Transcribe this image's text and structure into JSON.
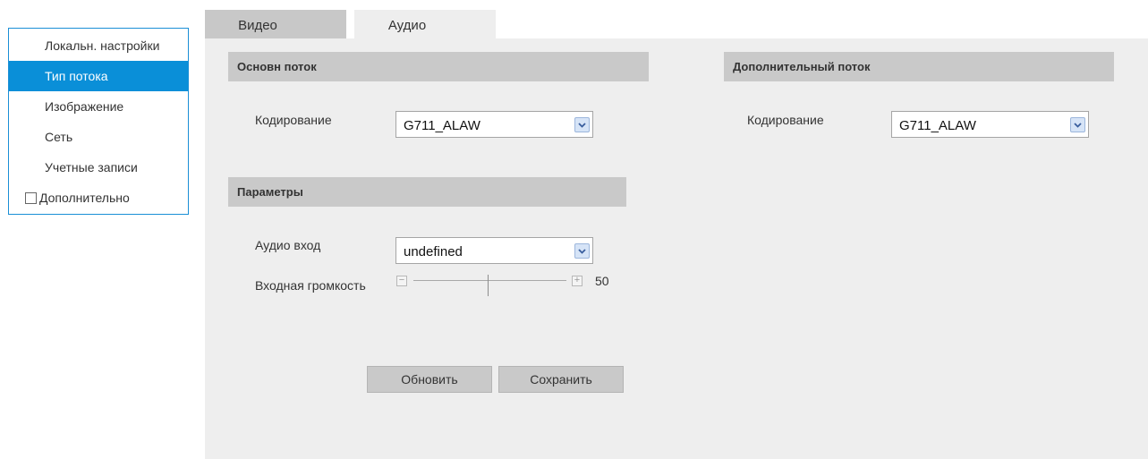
{
  "sidebar": {
    "items": [
      {
        "label": "Локальн. настройки"
      },
      {
        "label": "Тип потока"
      },
      {
        "label": "Изображение"
      },
      {
        "label": "Сеть"
      },
      {
        "label": "Учетные записи"
      },
      {
        "label": "Дополнительно"
      }
    ],
    "active_index": 1
  },
  "tabs": [
    {
      "label": "Видео"
    },
    {
      "label": "Аудио"
    }
  ],
  "main_stream": {
    "title": "Основн поток",
    "encoding_label": "Кодирование",
    "encoding_value": "G711_ALAW"
  },
  "sub_stream": {
    "title": "Дополнительный поток",
    "encoding_label": "Кодирование",
    "encoding_value": "G711_ALAW"
  },
  "params": {
    "title": "Параметры",
    "audio_input_label": "Аудио вход",
    "audio_input_value": "undefined",
    "input_volume_label": "Входная громкость",
    "input_volume_value": "50"
  },
  "buttons": {
    "refresh": "Обновить",
    "save": "Сохранить"
  },
  "colors": {
    "accent": "#0a8fd8",
    "panel_bg": "#eeeeee",
    "section_bar": "#c9c9c9"
  }
}
